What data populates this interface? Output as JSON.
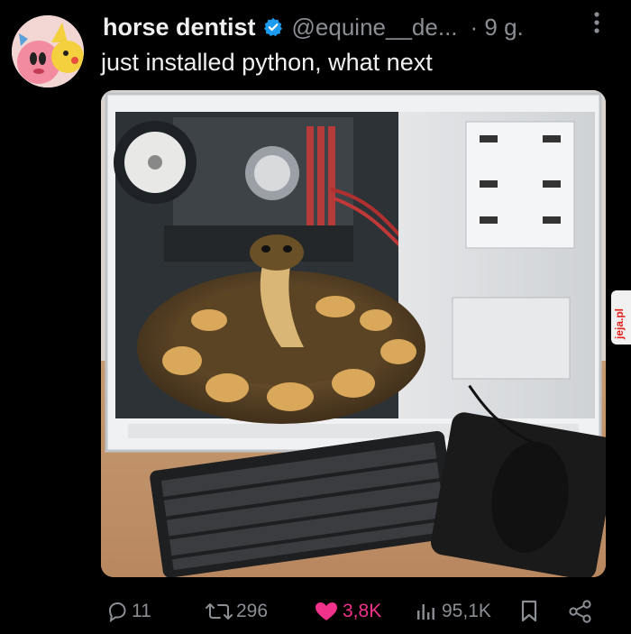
{
  "post": {
    "author_name": "horse dentist",
    "handle": "@equine__de...",
    "time": "· 9 g.",
    "text": "just installed python, what next"
  },
  "watermark": "jeja.pl",
  "actions": {
    "replies": "11",
    "reposts": "296",
    "likes": "3,8K",
    "views": "95,1K"
  },
  "colors": {
    "background": "#000000",
    "text": "#e7e9ea",
    "muted": "#8b8f94",
    "verified": "#1d9bf0",
    "like": "#f1328a"
  }
}
